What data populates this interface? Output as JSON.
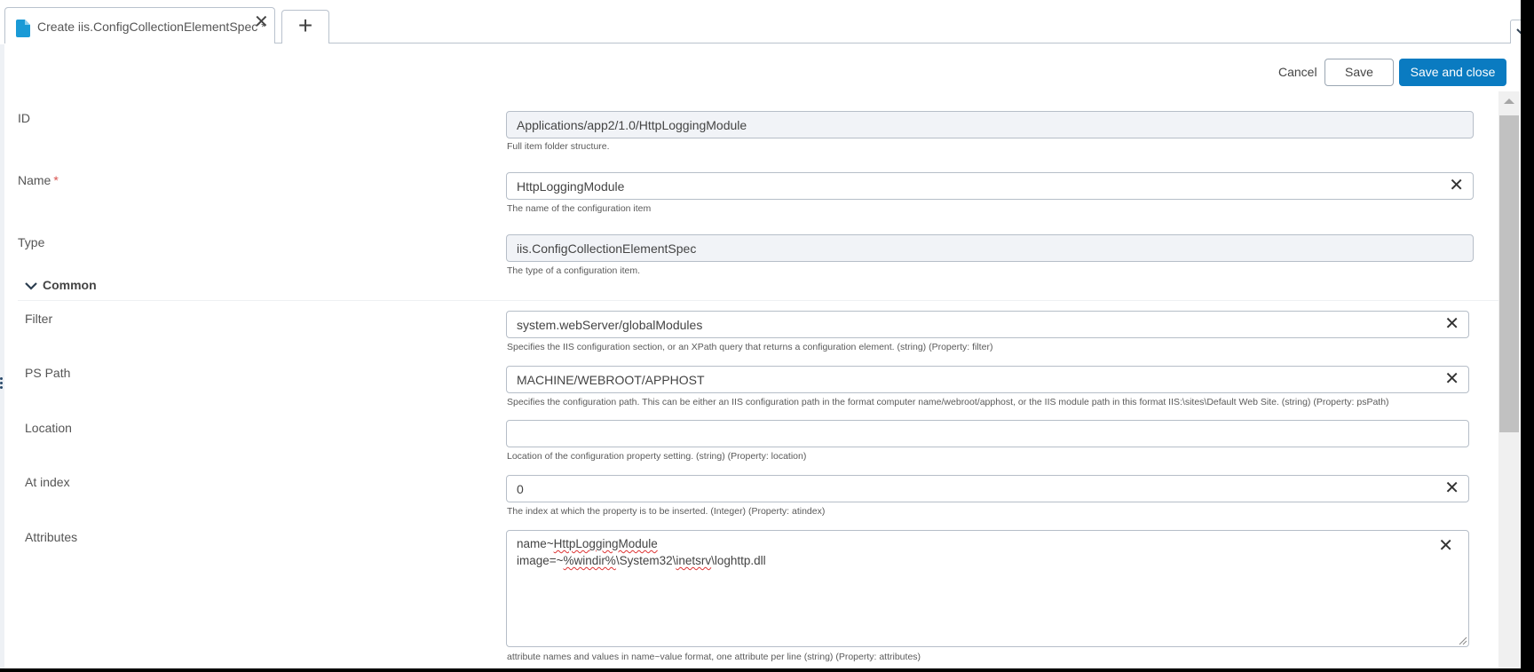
{
  "tabs": {
    "active_tab": {
      "title": "Create iis.ConfigCollectionElementSpec *",
      "icon": "document-icon",
      "close_icon": "close-icon"
    },
    "new_tab_label": "+",
    "dropdown_icon": "chevron-down-icon"
  },
  "actions": {
    "cancel": "Cancel",
    "save": "Save",
    "save_and_close": "Save and close"
  },
  "colors": {
    "primary": "#0a7bc1",
    "required": "#d9534f",
    "doc_icon": "#1a9ad6"
  },
  "form": {
    "id": {
      "label": "ID",
      "value": "Applications/app2/1.0/HttpLoggingModule",
      "help": "Full item folder structure.",
      "readonly": true
    },
    "name": {
      "label": "Name",
      "required_mark": "*",
      "value": "HttpLoggingModule",
      "help": "The name of the configuration item"
    },
    "type": {
      "label": "Type",
      "value": "iis.ConfigCollectionElementSpec",
      "help": "The type of a configuration item.",
      "readonly": true
    },
    "section": {
      "label": "Common",
      "expanded": true
    },
    "filter": {
      "label": "Filter",
      "value": "system.webServer/globalModules",
      "help": "Specifies the IIS configuration section, or an XPath query that returns a configuration element. (string) (Property: filter)"
    },
    "ps_path": {
      "label": "PS Path",
      "value": "MACHINE/WEBROOT/APPHOST",
      "help": "Specifies the configuration path. This can be either an IIS configuration path in the format computer name/webroot/apphost, or the IIS module path in this format IIS:\\sites\\Default Web Site. (string) (Property: psPath)"
    },
    "location": {
      "label": "Location",
      "value": "",
      "help": "Location of the configuration property setting. (string) (Property: location)"
    },
    "at_index": {
      "label": "At index",
      "value": "0",
      "help": "The index at which the property is to be inserted. (Integer) (Property: atindex)"
    },
    "attributes": {
      "label": "Attributes",
      "lines": [
        "name~HttpLoggingModule",
        "image=~%windir%\\System32\\inetsrv\\loghttp.dll"
      ],
      "line1_parts": [
        "name~",
        "HttpLoggingModule"
      ],
      "line2_parts": [
        "image=~",
        "%windir%",
        "\\System32\\",
        "inetsrv",
        "\\loghttp.dll"
      ],
      "help": "attribute names and values in name~value format, one attribute per line  (string) (Property: attributes)"
    }
  }
}
